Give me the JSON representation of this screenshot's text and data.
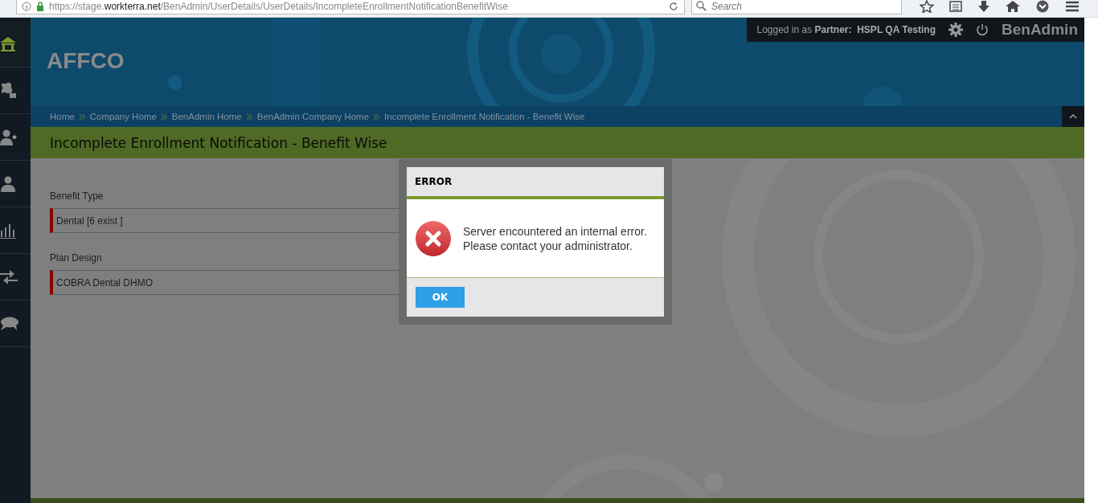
{
  "browser": {
    "url": "https://stage.**workterra.net**/BenAdmin/UserDetails/UserDetails/IncompleteEnrollmentNotificationBenefitWise",
    "search_placeholder": "Search"
  },
  "sidebar": {
    "items": [
      {
        "kind": "home",
        "selected": true
      },
      {
        "kind": "puzzle",
        "selected": false
      },
      {
        "kind": "user-star",
        "selected": false
      },
      {
        "kind": "user",
        "selected": false
      },
      {
        "kind": "chart",
        "selected": false
      },
      {
        "kind": "arrows",
        "selected": false
      },
      {
        "kind": "chat",
        "selected": false
      }
    ]
  },
  "header": {
    "login_label": "Logged in as",
    "role": "Partner:",
    "user": "HSPL QA Testing",
    "app_name": "BenAdmin",
    "company": "AFFCO"
  },
  "breadcrumbs": [
    "Home",
    "Company Home",
    "BenAdmin Home",
    "BenAdmin Company Home",
    "Incomplete Enrollment Notification - Benefit Wise"
  ],
  "page_title": "Incomplete Enrollment Notification - Benefit Wise",
  "fields": [
    {
      "label": "Benefit Type",
      "value": "Dental [6 exist ]"
    },
    {
      "label": "Plan Design",
      "value": "COBRA Dental DHMO"
    }
  ],
  "dialog": {
    "title": "ERROR",
    "message_lines": [
      "Server encountered an internal error.",
      "Please contact your administrator."
    ],
    "ok_button": "OK"
  }
}
